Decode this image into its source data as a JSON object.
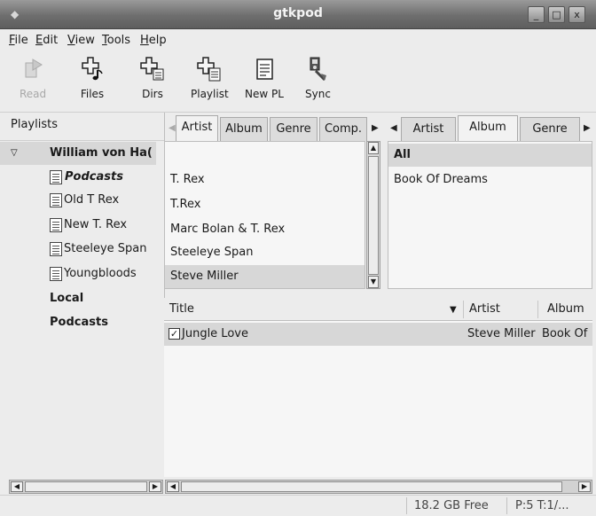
{
  "window": {
    "title": "gtkpod",
    "controls": {
      "minimize": "_",
      "maximize": "□",
      "close": "x"
    }
  },
  "menu": [
    {
      "label": "File",
      "mnemonic": "F",
      "rest": "ile"
    },
    {
      "label": "Edit",
      "mnemonic": "E",
      "rest": "dit"
    },
    {
      "label": "View",
      "mnemonic": "V",
      "rest": "iew"
    },
    {
      "label": "Tools",
      "mnemonic": "T",
      "rest": "ools"
    },
    {
      "label": "Help",
      "mnemonic": "H",
      "rest": "elp"
    }
  ],
  "toolbar": {
    "read": "Read",
    "files": "Files",
    "dirs": "Dirs",
    "playlist": "Playlist",
    "new_pl": "New PL",
    "sync": "Sync"
  },
  "playlists": {
    "header": "Playlists",
    "ipod_name": "William von Ha(",
    "items": [
      "Podcasts",
      "Old T Rex",
      "New T. Rex",
      "Steeleye Span",
      "Youngbloods"
    ],
    "local": "Local",
    "podcasts": "Podcasts"
  },
  "left_tabs": [
    "Artist",
    "Album",
    "Genre",
    "Comp."
  ],
  "right_tabs": [
    "Artist",
    "Album",
    "Genre"
  ],
  "artists": [
    "",
    "T. Rex",
    "T.Rex",
    "Marc Bolan & T. Rex",
    "Steeleye Span",
    "Steve Miller"
  ],
  "albums": [
    "All",
    "Book Of Dreams"
  ],
  "tracks": {
    "columns": {
      "title": "Title",
      "artist": "Artist",
      "album": "Album"
    },
    "rows": [
      {
        "checked": "☑",
        "title": "Jungle Love",
        "artist": "Steve Miller",
        "album": "Book Of"
      }
    ]
  },
  "status": {
    "free": "18.2 GB Free",
    "stats": "P:5 T:1/..."
  },
  "colors": {
    "titlebar": "#6e6e6e",
    "selection": "#d7d7d7",
    "window_bg": "#ececec"
  }
}
